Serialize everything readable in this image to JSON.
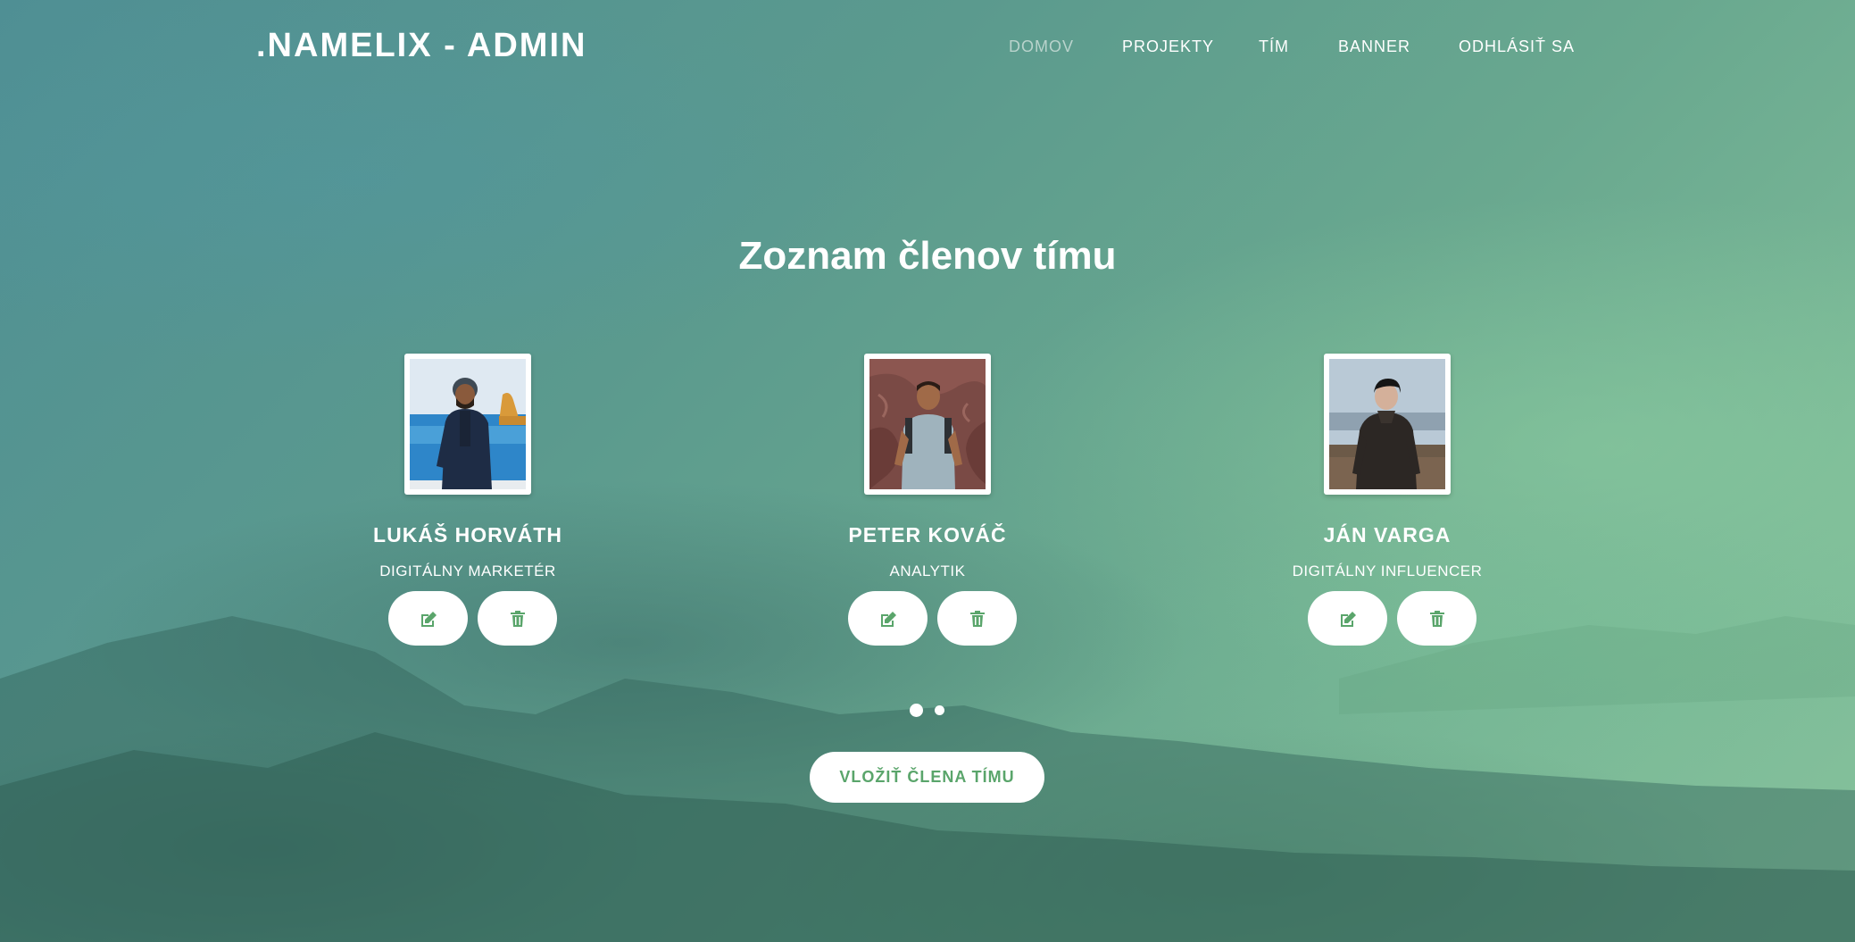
{
  "header": {
    "brand": ".NAMELIX - ADMIN",
    "nav": [
      {
        "label": "DOMOV",
        "active": true
      },
      {
        "label": "PROJEKTY",
        "active": false
      },
      {
        "label": "TÍM",
        "active": false
      },
      {
        "label": "BANNER",
        "active": false
      },
      {
        "label": "ODHLÁSIŤ SA",
        "active": false
      }
    ]
  },
  "main": {
    "title": "Zoznam členov tímu",
    "members": [
      {
        "name": "LUKÁŠ HORVÁTH",
        "role": "DIGITÁLNY MARKETÉR",
        "photo": "man-by-sea-photo"
      },
      {
        "name": "PETER KOVÁČ",
        "role": "ANALYTIK",
        "photo": "man-in-canyon-photo"
      },
      {
        "name": "JÁN VARGA",
        "role": "DIGITÁLNY INFLUENCER",
        "photo": "man-in-field-photo"
      }
    ],
    "edit_icon": "edit-icon",
    "delete_icon": "trash-icon",
    "pagination": {
      "pages": 2,
      "current": 1
    },
    "add_button": "VLOŽIŤ ČLENA TÍMU"
  },
  "colors": {
    "accent": "#5aa56b",
    "nav_active": "#b9d3cc",
    "background_start": "#4f8f94",
    "background_end": "#86c29c"
  }
}
